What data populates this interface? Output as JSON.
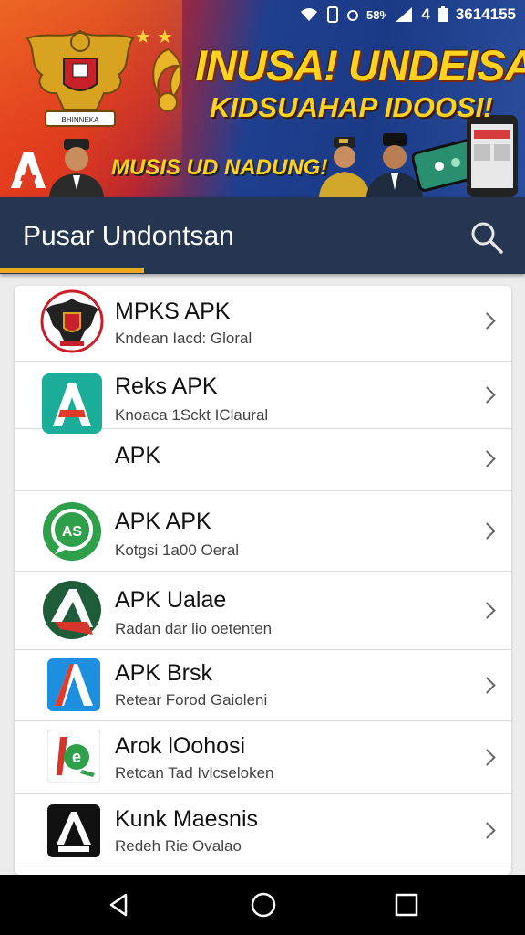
{
  "status_bar": {
    "wifi_icon": "wifi-icon",
    "time": "3614155",
    "signal_text": "4",
    "battery_icon": "battery-icon"
  },
  "banner": {
    "title": "INUSA! UNDEISAN",
    "subtitle": "KIDSUAHAP IDOOSI!",
    "slogan": "MUSIS UD NADUNG!",
    "emblem_text": "BHINNEKA"
  },
  "app_bar": {
    "title": "Pusar Undontsan",
    "search_icon": "search-icon",
    "accent_color": "#f1a81e",
    "bar_color": "#263650"
  },
  "apps": [
    {
      "title": "MPKS APK",
      "subtitle": "Kndean Iacd: Gloral",
      "icon": "garuda-emblem-icon"
    },
    {
      "title": "Reks APK",
      "subtitle": "Knoaca 1Sckt IClaural",
      "icon": "teal-a-icon"
    },
    {
      "title": "APK",
      "subtitle": "",
      "icon": ""
    },
    {
      "title": "APK APK",
      "subtitle": "Kotgsi 1a00 Oeral",
      "icon": "green-chat-icon"
    },
    {
      "title": "APK Ualae",
      "subtitle": "Radan dar lio oetenten",
      "icon": "green-red-a-icon"
    },
    {
      "title": "APK Brsk",
      "subtitle": "Retear Forod Gaioleni",
      "icon": "blue-a-icon"
    },
    {
      "title": "Arok lOohosi",
      "subtitle": "Retcan Tad Ivlcseloken",
      "icon": "green-e-icon"
    },
    {
      "title": "Kunk Maesnis",
      "subtitle": "Redeh Rie Ovalao",
      "icon": "black-a-icon"
    }
  ],
  "nav_bar": {
    "back_icon": "back-icon",
    "home_icon": "home-icon",
    "recents_icon": "recents-icon"
  }
}
